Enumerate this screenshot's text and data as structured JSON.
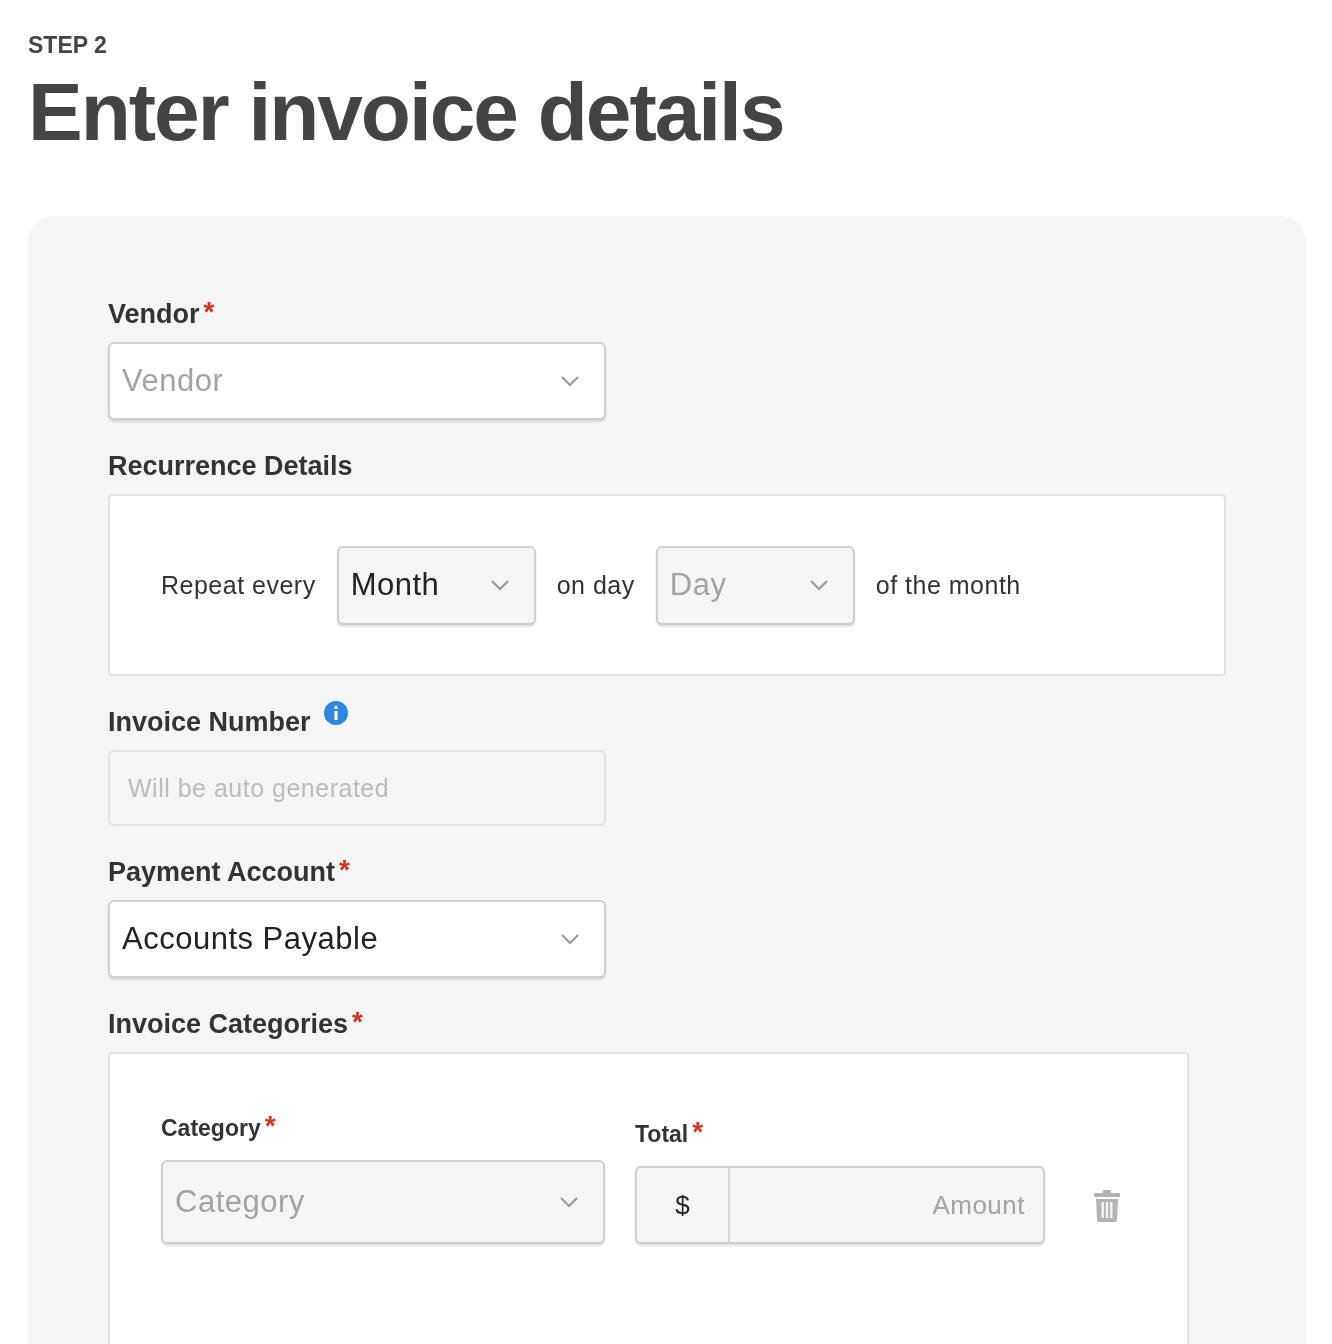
{
  "step": "STEP 2",
  "title": "Enter invoice details",
  "fields": [
    {
      "kind": "select",
      "label": "Vendor",
      "required_mark": "*",
      "placeholder": "Vendor"
    },
    {
      "kind": "recurrence",
      "label": "Recurrence Details",
      "parts": [
        {
          "kind": "text",
          "text": "Repeat every"
        },
        {
          "kind": "select",
          "value": "Month"
        },
        {
          "kind": "text",
          "text": "on day"
        },
        {
          "kind": "select",
          "placeholder": "Day"
        },
        {
          "kind": "text",
          "text": "of the month"
        }
      ]
    },
    {
      "kind": "input",
      "label": "Invoice Number",
      "info": true,
      "disabled": true,
      "placeholder": "Will be auto generated"
    },
    {
      "kind": "select",
      "label": "Payment Account",
      "required_mark": "*",
      "value": "Accounts Payable"
    },
    {
      "kind": "categories",
      "label": "Invoice Categories",
      "required_mark": "*",
      "rows": [
        {
          "category": {
            "label": "Category",
            "required_mark": "*",
            "placeholder": "Category"
          },
          "total": {
            "label": "Total",
            "required_mark": "*",
            "prefix": "$",
            "placeholder": "Amount"
          }
        }
      ]
    }
  ]
}
